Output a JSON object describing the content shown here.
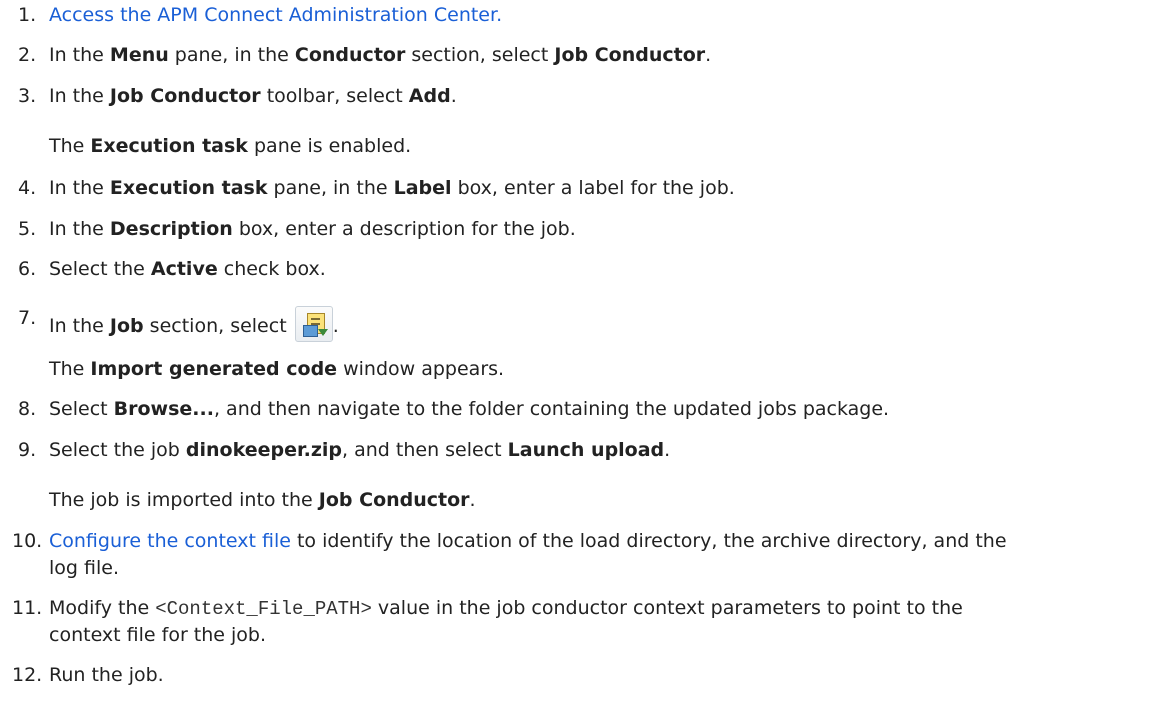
{
  "steps": [
    {
      "num": "1.",
      "link": "Access the APM Connect Administration Center."
    },
    {
      "num": "2.",
      "a": "In the ",
      "b1": "Menu",
      "c": " pane, in the ",
      "b2": "Conductor",
      "d": " section, select ",
      "b3": "Job Conductor",
      "e": "."
    },
    {
      "num": "3.",
      "a": "In the ",
      "b1": "Job Conductor",
      "c": " toolbar, select ",
      "b2": "Add",
      "d": ".",
      "note": {
        "a": "The ",
        "b": "Execution task",
        "c": " pane is enabled."
      }
    },
    {
      "num": "4.",
      "a": "In the ",
      "b1": "Execution task",
      "c": " pane, in the ",
      "b2": "Label",
      "d": " box, enter a label for the job."
    },
    {
      "num": "5.",
      "a": "In the ",
      "b1": "Description",
      "c": " box, enter a description for the job."
    },
    {
      "num": "6.",
      "a": "Select the ",
      "b1": "Active",
      "c": " check box."
    },
    {
      "num": "7.",
      "a": "In the ",
      "b1": "Job",
      "c": " section, select ",
      "icon": "import-code-icon",
      "d": ".",
      "note": {
        "a": "The ",
        "b": "Import generated code",
        "c": " window appears."
      }
    },
    {
      "num": "8.",
      "a": "Select ",
      "b1": "Browse...",
      "c": ", and then navigate to the folder containing the updated jobs package."
    },
    {
      "num": "9.",
      "a": "Select the job ",
      "b1": "dinokeeper.zip",
      "c": ", and then select ",
      "b2": "Launch upload",
      "d": ".",
      "note": {
        "a": "The job is imported into the ",
        "b": "Job Conductor",
        "c": "."
      }
    },
    {
      "num": "10.",
      "link": "Configure the context file",
      "a": " to identify the location of the load directory, the archive directory, and the",
      "line2": "log file."
    },
    {
      "num": "11.",
      "a": "Modify the ",
      "code": "<Context_File_PATH>",
      "c": " value in the job conductor context parameters to point to the",
      "line2": "context file for the job."
    },
    {
      "num": "12.",
      "a": "Run the job."
    }
  ],
  "colors": {
    "link": "#1a5fd6",
    "text": "#222222"
  }
}
